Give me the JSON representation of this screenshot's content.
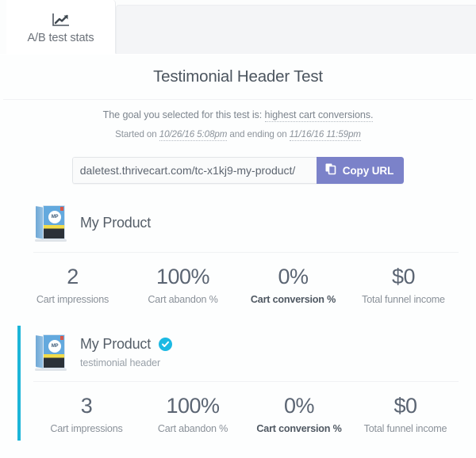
{
  "tabs": [
    {
      "id": "ab-test-stats",
      "label": "A/B test stats",
      "icon": "line-chart-up-icon",
      "active": true
    }
  ],
  "test": {
    "title": "Testimonial Header Test",
    "goal_prefix": "The goal you selected for this test is: ",
    "goal_value": "highest cart conversions.",
    "schedule_prefix": "Started on ",
    "start_date": "10/26/16 5:08pm",
    "schedule_middle": " and ending on ",
    "end_date": "11/16/16 11:59pm"
  },
  "url_bar": {
    "value": "daletest.thrivecart.com/tc-x1kj9-my-product/",
    "placeholder": "Enter URL",
    "copy_button_label": "Copy URL",
    "copy_icon": "copy-pages-icon",
    "button_color": "#7b82c9"
  },
  "variants": [
    {
      "name": "My Product",
      "subtitle": "",
      "is_winner": false,
      "thumbnail_initials": "MP",
      "thumbnail_alt": "product-box-thumbnail",
      "stats": [
        {
          "value": "2",
          "label": "Cart impressions",
          "is_goal": false
        },
        {
          "value": "100%",
          "label": "Cart abandon %",
          "is_goal": false
        },
        {
          "value": "0%",
          "label": "Cart conversion %",
          "is_goal": true
        },
        {
          "value": "$0",
          "label": "Total funnel income",
          "is_goal": false
        }
      ]
    },
    {
      "name": "My Product",
      "subtitle": "testimonial header",
      "is_winner": true,
      "winner_badge_color": "#1cb9e3",
      "thumbnail_initials": "MP",
      "thumbnail_alt": "product-box-thumbnail",
      "stats": [
        {
          "value": "3",
          "label": "Cart impressions",
          "is_goal": false
        },
        {
          "value": "100%",
          "label": "Cart abandon %",
          "is_goal": false
        },
        {
          "value": "0%",
          "label": "Cart conversion %",
          "is_goal": true
        },
        {
          "value": "$0",
          "label": "Total funnel income",
          "is_goal": false
        }
      ]
    }
  ]
}
